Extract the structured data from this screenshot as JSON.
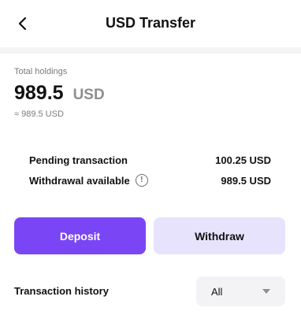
{
  "header": {
    "title": "USD Transfer",
    "back_icon": "chevron-left-icon"
  },
  "holdings": {
    "label": "Total holdings",
    "amount": "989.5",
    "currency": "USD",
    "approx": "≈ 989.5 USD"
  },
  "details": {
    "pending_label": "Pending transaction",
    "pending_value": "100.25 USD",
    "withdrawal_label": "Withdrawal available",
    "withdrawal_value": "989.5 USD",
    "info_icon": "info-icon"
  },
  "actions": {
    "deposit_label": "Deposit",
    "withdraw_label": "Withdraw"
  },
  "history": {
    "title": "Transaction history",
    "filter_value": "All"
  },
  "colors": {
    "accent": "#7a45f5",
    "accent_light": "#e7e3fd"
  }
}
